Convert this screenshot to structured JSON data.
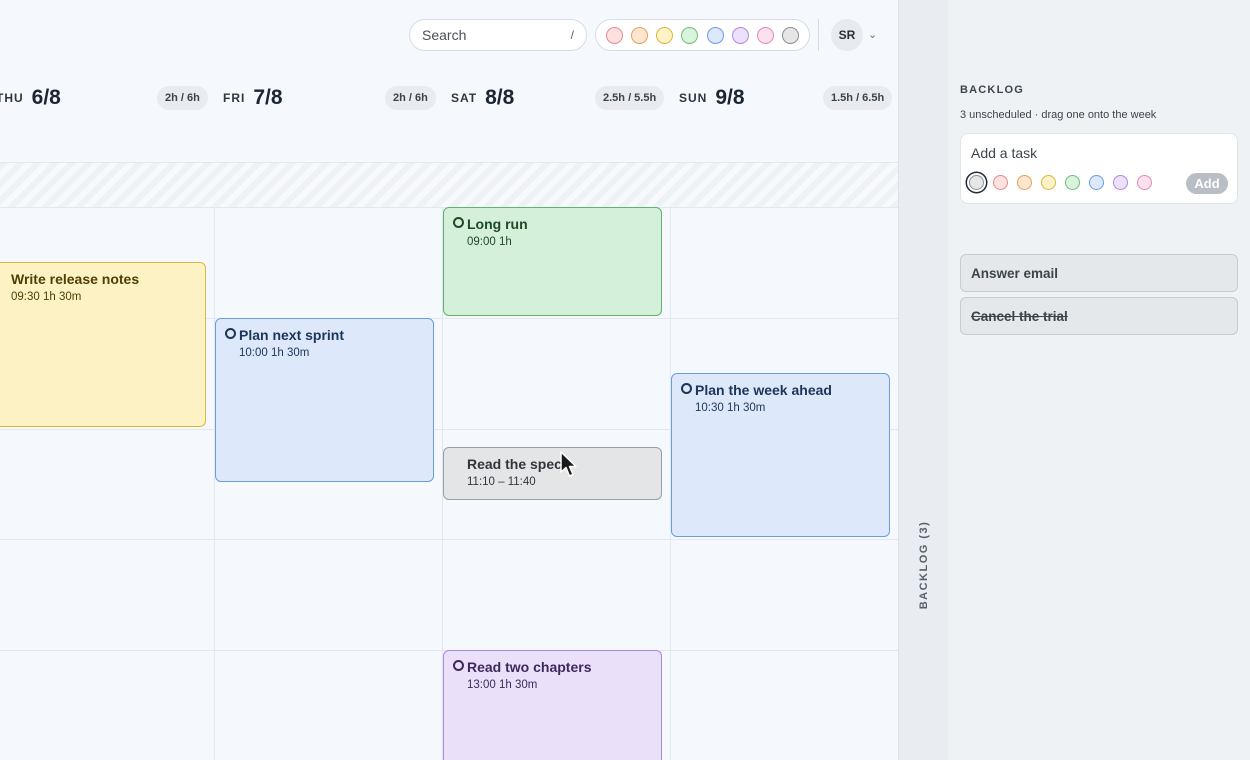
{
  "header": {
    "search_placeholder": "Search",
    "search_shortcut": "/",
    "color_filters": [
      {
        "name": "red",
        "fill": "#fde1e1",
        "stroke": "#e58a8a"
      },
      {
        "name": "orange",
        "fill": "#fde6cf",
        "stroke": "#e0a05c"
      },
      {
        "name": "yellow",
        "fill": "#fdf3c6",
        "stroke": "#d8b73c"
      },
      {
        "name": "green",
        "fill": "#d9f3dd",
        "stroke": "#6cbf7a"
      },
      {
        "name": "blue",
        "fill": "#dce8fb",
        "stroke": "#6e9be0"
      },
      {
        "name": "purple",
        "fill": "#ece0fb",
        "stroke": "#ad8ae0"
      },
      {
        "name": "pink",
        "fill": "#fbe0ef",
        "stroke": "#e08ab9"
      },
      {
        "name": "gray",
        "fill": "#e6e6e6",
        "stroke": "#8a8f94"
      }
    ],
    "avatar_initials": "SR"
  },
  "days": [
    {
      "dow": "THU",
      "date": "6/8",
      "hours": "2h / 6h"
    },
    {
      "dow": "FRI",
      "date": "7/8",
      "hours": "2h / 6h"
    },
    {
      "dow": "SAT",
      "date": "8/8",
      "hours": "2.5h / 5.5h"
    },
    {
      "dow": "SUN",
      "date": "9/8",
      "hours": "1.5h / 6.5h"
    }
  ],
  "events": [
    {
      "title": "Write release notes",
      "time": "09:30  1h 30m",
      "color": "yellow"
    },
    {
      "title": "Plan next sprint",
      "time": "10:00  1h 30m",
      "color": "blue"
    },
    {
      "title": "Long run",
      "time": "09:00  1h",
      "color": "green"
    },
    {
      "title": "Read the spec",
      "time": "11:10 – 11:40",
      "color": "gray"
    },
    {
      "title": "Read two chapters",
      "time": "13:00  1h 30m",
      "color": "purple"
    },
    {
      "title": "Plan the week ahead",
      "time": "10:30  1h 30m",
      "color": "blue"
    }
  ],
  "backlog": {
    "rail_label": "BACKLOG (3)",
    "title": "BACKLOG",
    "subtitle": "3 unscheduled · drag one onto the week",
    "add_placeholder": "Add a task",
    "add_button": "Add",
    "items": [
      {
        "title": "Answer email",
        "done": false
      },
      {
        "title": "Cancel the trial",
        "done": true
      }
    ]
  }
}
